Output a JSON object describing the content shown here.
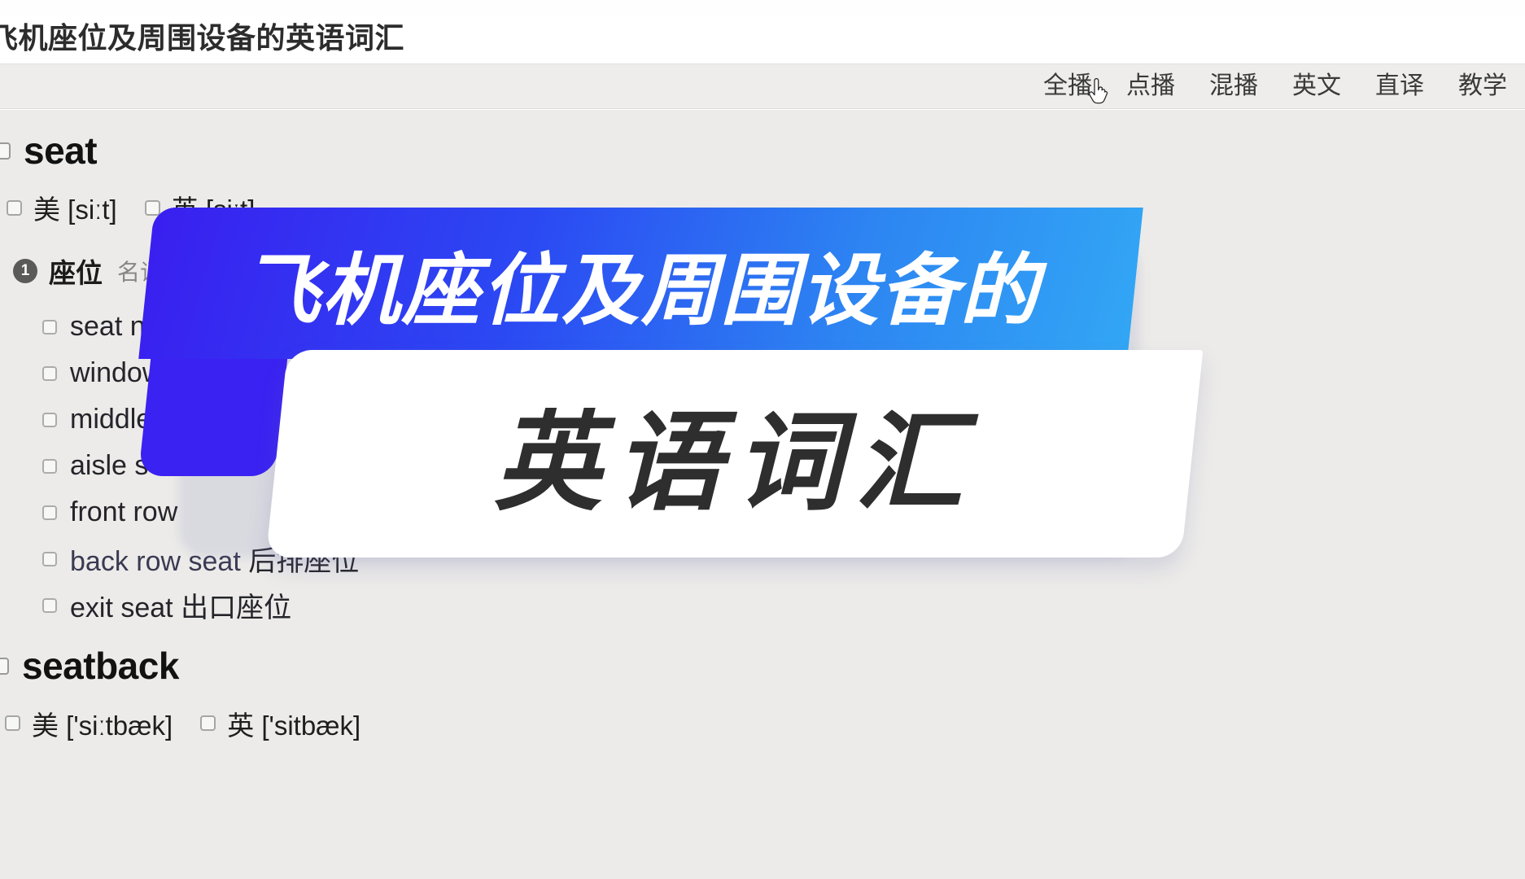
{
  "window": {
    "title": "飞机座位及周围设备的英语词汇"
  },
  "nav": {
    "items": [
      {
        "label": "全播",
        "name": "nav-quanbo",
        "active": true
      },
      {
        "label": "点播",
        "name": "nav-dianbo",
        "active": false
      },
      {
        "label": "混播",
        "name": "nav-hunbo",
        "active": false
      },
      {
        "label": "英文",
        "name": "nav-yingwen",
        "active": false
      },
      {
        "label": "直译",
        "name": "nav-zhiyi",
        "active": false
      },
      {
        "label": "教学",
        "name": "nav-jiaoxue",
        "active": false
      }
    ]
  },
  "entries": [
    {
      "headword": "seat",
      "phonetics": [
        {
          "region": "美",
          "ipa": "[siːt]"
        },
        {
          "region": "英",
          "ipa": "[siːt]"
        }
      ],
      "senses": [
        {
          "index": "1",
          "definition": "座位",
          "pos": "名词 (n.)",
          "phrases": [
            {
              "en": "seat num",
              "cn": "",
              "occluded": true
            },
            {
              "en": "window",
              "cn": "",
              "occluded": true
            },
            {
              "en": "middle",
              "cn": "",
              "occluded": true
            },
            {
              "en": "aisle s",
              "cn": "",
              "occluded": true
            },
            {
              "en": "front row",
              "cn": "",
              "occluded": true
            },
            {
              "en": "back row seat",
              "cn": "后排座位",
              "occluded": false
            },
            {
              "en": "exit seat",
              "cn": "出口座位",
              "occluded": false
            }
          ]
        }
      ]
    },
    {
      "headword": "seatback",
      "phonetics": [
        {
          "region": "美",
          "ipa": "['siːtbæk]"
        },
        {
          "region": "英",
          "ipa": "['sitbæk]"
        }
      ],
      "senses": []
    }
  ],
  "promo": {
    "line1": "飞机座位及周围设备的",
    "line2": "英语词汇",
    "gradient_from": "#3a1ff0",
    "gradient_to": "#32a6f5",
    "card_background": "#ffffff",
    "line2_color": "#2e2e2e"
  },
  "colors": {
    "page_background": "#ffffff",
    "content_background": "#ecebe9",
    "navbar_background": "#eeedeb",
    "title_color": "#2c2c2c",
    "headword_color": "#121212",
    "pos_color": "#868684",
    "sense_badge": "#5a5a58"
  },
  "cursor": {
    "icon": "pointing-hand-cursor",
    "over": "全播"
  }
}
